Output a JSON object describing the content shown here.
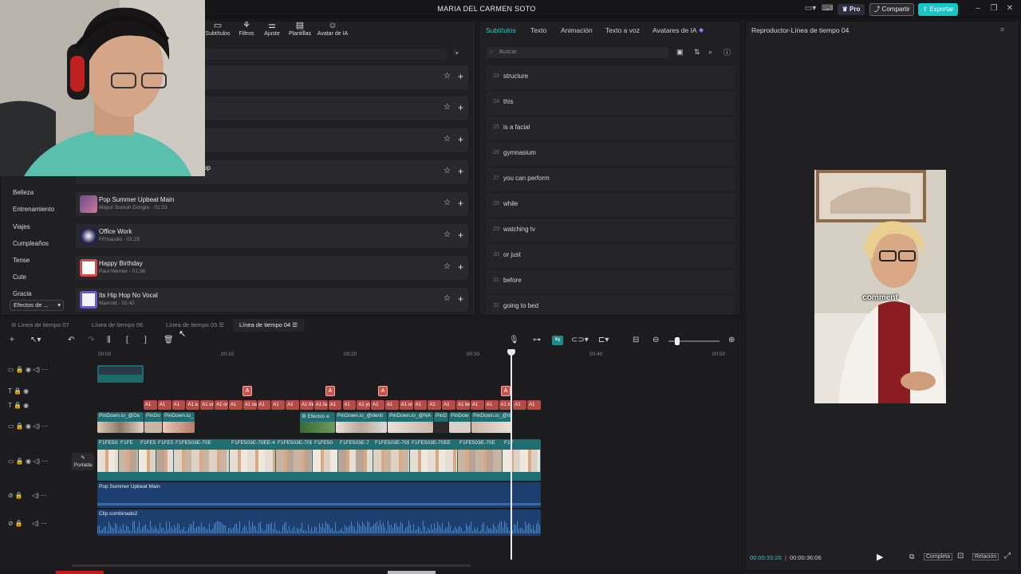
{
  "app": {
    "title": "MARIA DEL CARMEN SOTO",
    "pro_label": "Pro",
    "share_label": "Compartir",
    "export_label": "Exportar"
  },
  "toolbar": {
    "tabs": [
      "Subtítulos",
      "Filtros",
      "Ajuste",
      "Plantillas",
      "Avatar de IA"
    ]
  },
  "music": {
    "rows": [
      {
        "title": "",
        "sub": ""
      },
      {
        "title": "",
        "sub": ""
      },
      {
        "title": "",
        "sub": ""
      },
      {
        "title": "op",
        "sub": ""
      },
      {
        "title": "Pop Summer Upbeat Main",
        "sub": "Mayur Suresh Dongre · 01:33"
      },
      {
        "title": "Office Work",
        "sub": "FFmaudio · 01:25"
      },
      {
        "title": "Happy Birthday",
        "sub": "Paul Werner · 01:38"
      },
      {
        "title": "Its Hip Hop No Vocal",
        "sub": "Maxcott · 01:42"
      }
    ]
  },
  "categories": [
    "Belleza",
    "Entrenamiento",
    "Viajes",
    "Cumpleaños",
    "Tense",
    "Cute",
    "Gracia"
  ],
  "category_dropdown": "Efectos de ...",
  "subtitles": {
    "tabs": [
      "Subtítulos",
      "Texto",
      "Animación",
      "Texto a voz",
      "Avatares de IA"
    ],
    "search_placeholder": "Buscar",
    "rows": [
      {
        "n": "23",
        "text": "structure"
      },
      {
        "n": "24",
        "text": "this"
      },
      {
        "n": "25",
        "text": "is a facial"
      },
      {
        "n": "26",
        "text": "gymnasium"
      },
      {
        "n": "27",
        "text": "you can perform"
      },
      {
        "n": "28",
        "text": "while"
      },
      {
        "n": "29",
        "text": "watching tv"
      },
      {
        "n": "30",
        "text": "or just"
      },
      {
        "n": "31",
        "text": "before"
      },
      {
        "n": "32",
        "text": "going to bed"
      }
    ]
  },
  "player": {
    "title": "Reproductor-Línea de tiempo 04",
    "caption": "comment",
    "time_current": "00:00:33:20",
    "time_total": "00:00:36:06",
    "complete_label": "Completa",
    "ratio_label": "Relación"
  },
  "timeline": {
    "tabs": [
      "Línea de tiempo 07",
      "Línea de tiempo 06",
      "Línea de tiempo 03",
      "Línea de tiempo 04"
    ],
    "ruler": [
      "00:00",
      "00:10",
      "00:20",
      "00:30",
      "00:40",
      "00:50"
    ],
    "cover_label": "Portada",
    "audio1_label": "Pop Summer Upbeat Main",
    "audio2_label": "Clip combinado2",
    "overlay_labels": [
      "PinDown.io_@De",
      "PinDo",
      "PinDown.io_",
      "Efectos e",
      "PinDown.io_@denti",
      "PinDown.io_@NA",
      "PinD",
      "PinDow",
      "PinDown.io_@d"
    ],
    "main_labels": [
      "F1FE503E-",
      "F1FE",
      "F1FE5",
      "F1FE5",
      "F1FE503E-70E",
      "F1FE503E-70EE-4",
      "F1FE503E-70E",
      "F1FE50",
      "F1FE503E-7",
      "F1FE503E-70E",
      "F1FE503E-70EE",
      "F1FE503E-70E",
      "F1F"
    ],
    "text_chips": [
      "A1",
      "A1",
      "A1",
      "A1 a",
      "A1 ur",
      "A1 or",
      "A1",
      "A1 se",
      "A1",
      "A1",
      "A1",
      "A1 thi",
      "A1 fa",
      "A1",
      "A1",
      "A1 yo",
      "A1",
      "A1",
      "A1 or",
      "A1",
      "A1",
      "A1",
      "A1 bef",
      "A1",
      "A1",
      "A1 inco",
      "A1",
      "A1"
    ]
  },
  "colors": {
    "accent": "#18c4c4",
    "text_clip": "#b64a45",
    "video_clip": "#1e6e72",
    "audio_clip": "#1d3f70"
  }
}
